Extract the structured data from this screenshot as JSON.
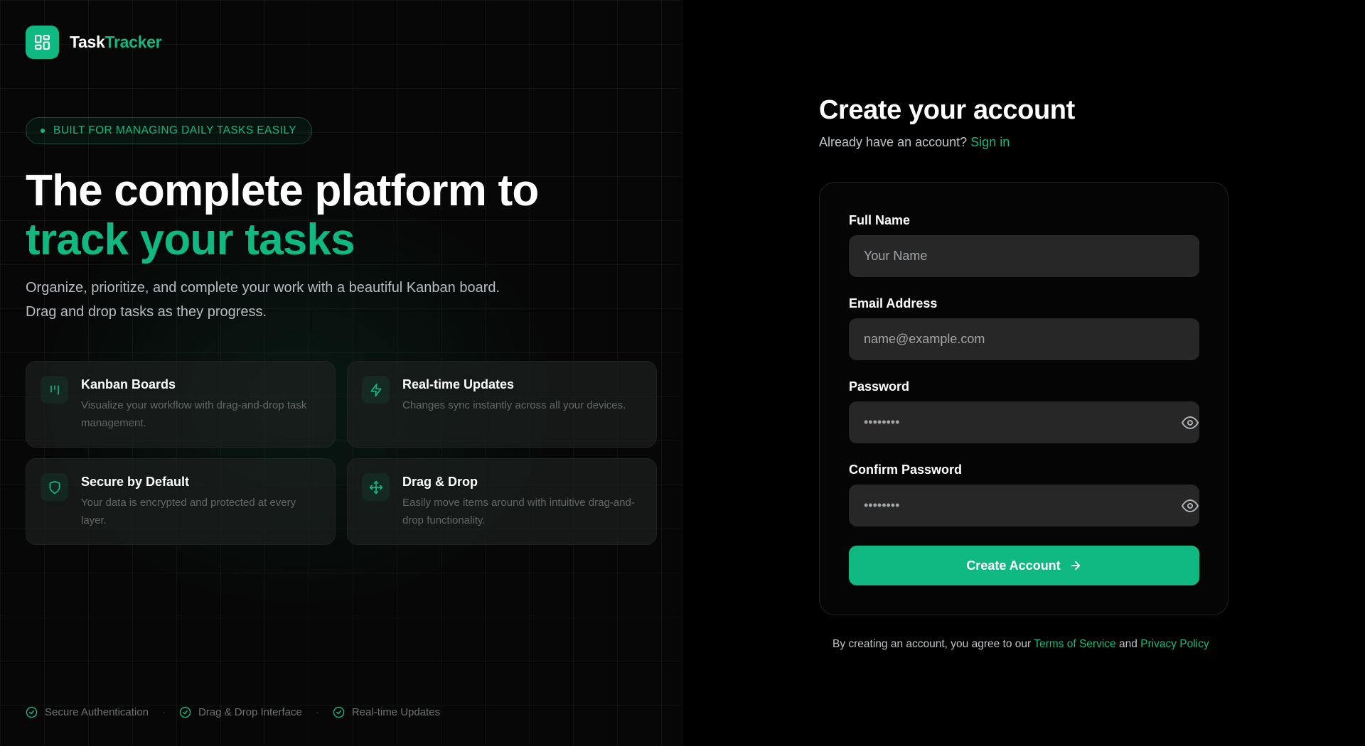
{
  "brand": {
    "name_part1": "Task",
    "name_part2": "Tracker",
    "logo_icon": "layout-grid-icon"
  },
  "hero": {
    "badge": "BUILT FOR MANAGING DAILY TASKS EASILY",
    "headline_line1": "The complete platform to",
    "headline_line2": "track your tasks",
    "subtitle_line1": "Organize, prioritize, and complete your work with a beautiful Kanban board.",
    "subtitle_line2": "Drag and drop tasks as they progress."
  },
  "features": [
    {
      "icon": "kanban-icon",
      "title": "Kanban Boards",
      "description": "Visualize your workflow with drag-and-drop task management."
    },
    {
      "icon": "lightning-icon",
      "title": "Real-time Updates",
      "description": "Changes sync instantly across all your devices."
    },
    {
      "icon": "shield-icon",
      "title": "Secure by Default",
      "description": "Your data is encrypted and protected at every layer."
    },
    {
      "icon": "move-icon",
      "title": "Drag & Drop",
      "description": "Easily move items around with intuitive drag-and-drop functionality."
    }
  ],
  "footer": {
    "items": [
      "Secure Authentication",
      "Drag & Drop Interface",
      "Real-time Updates"
    ],
    "separator": "·"
  },
  "form": {
    "title": "Create your account",
    "signin_prompt": "Already have an account?",
    "signin_link": "Sign in",
    "fields": {
      "full_name": {
        "label": "Full Name",
        "placeholder": "Your Name",
        "value": ""
      },
      "email": {
        "label": "Email Address",
        "placeholder": "name@example.com",
        "value": ""
      },
      "password": {
        "label": "Password",
        "placeholder": "••••••••",
        "value": ""
      },
      "confirm_password": {
        "label": "Confirm Password",
        "placeholder": "••••••••",
        "value": ""
      }
    },
    "submit_label": "Create Account"
  },
  "terms": {
    "prefix": "By creating an account, you agree to our",
    "tos_link": "Terms of Service",
    "and": "and",
    "privacy_link": "Privacy Policy"
  },
  "colors": {
    "accent": "#10b981",
    "background": "#000000",
    "input_bg": "#272727"
  }
}
